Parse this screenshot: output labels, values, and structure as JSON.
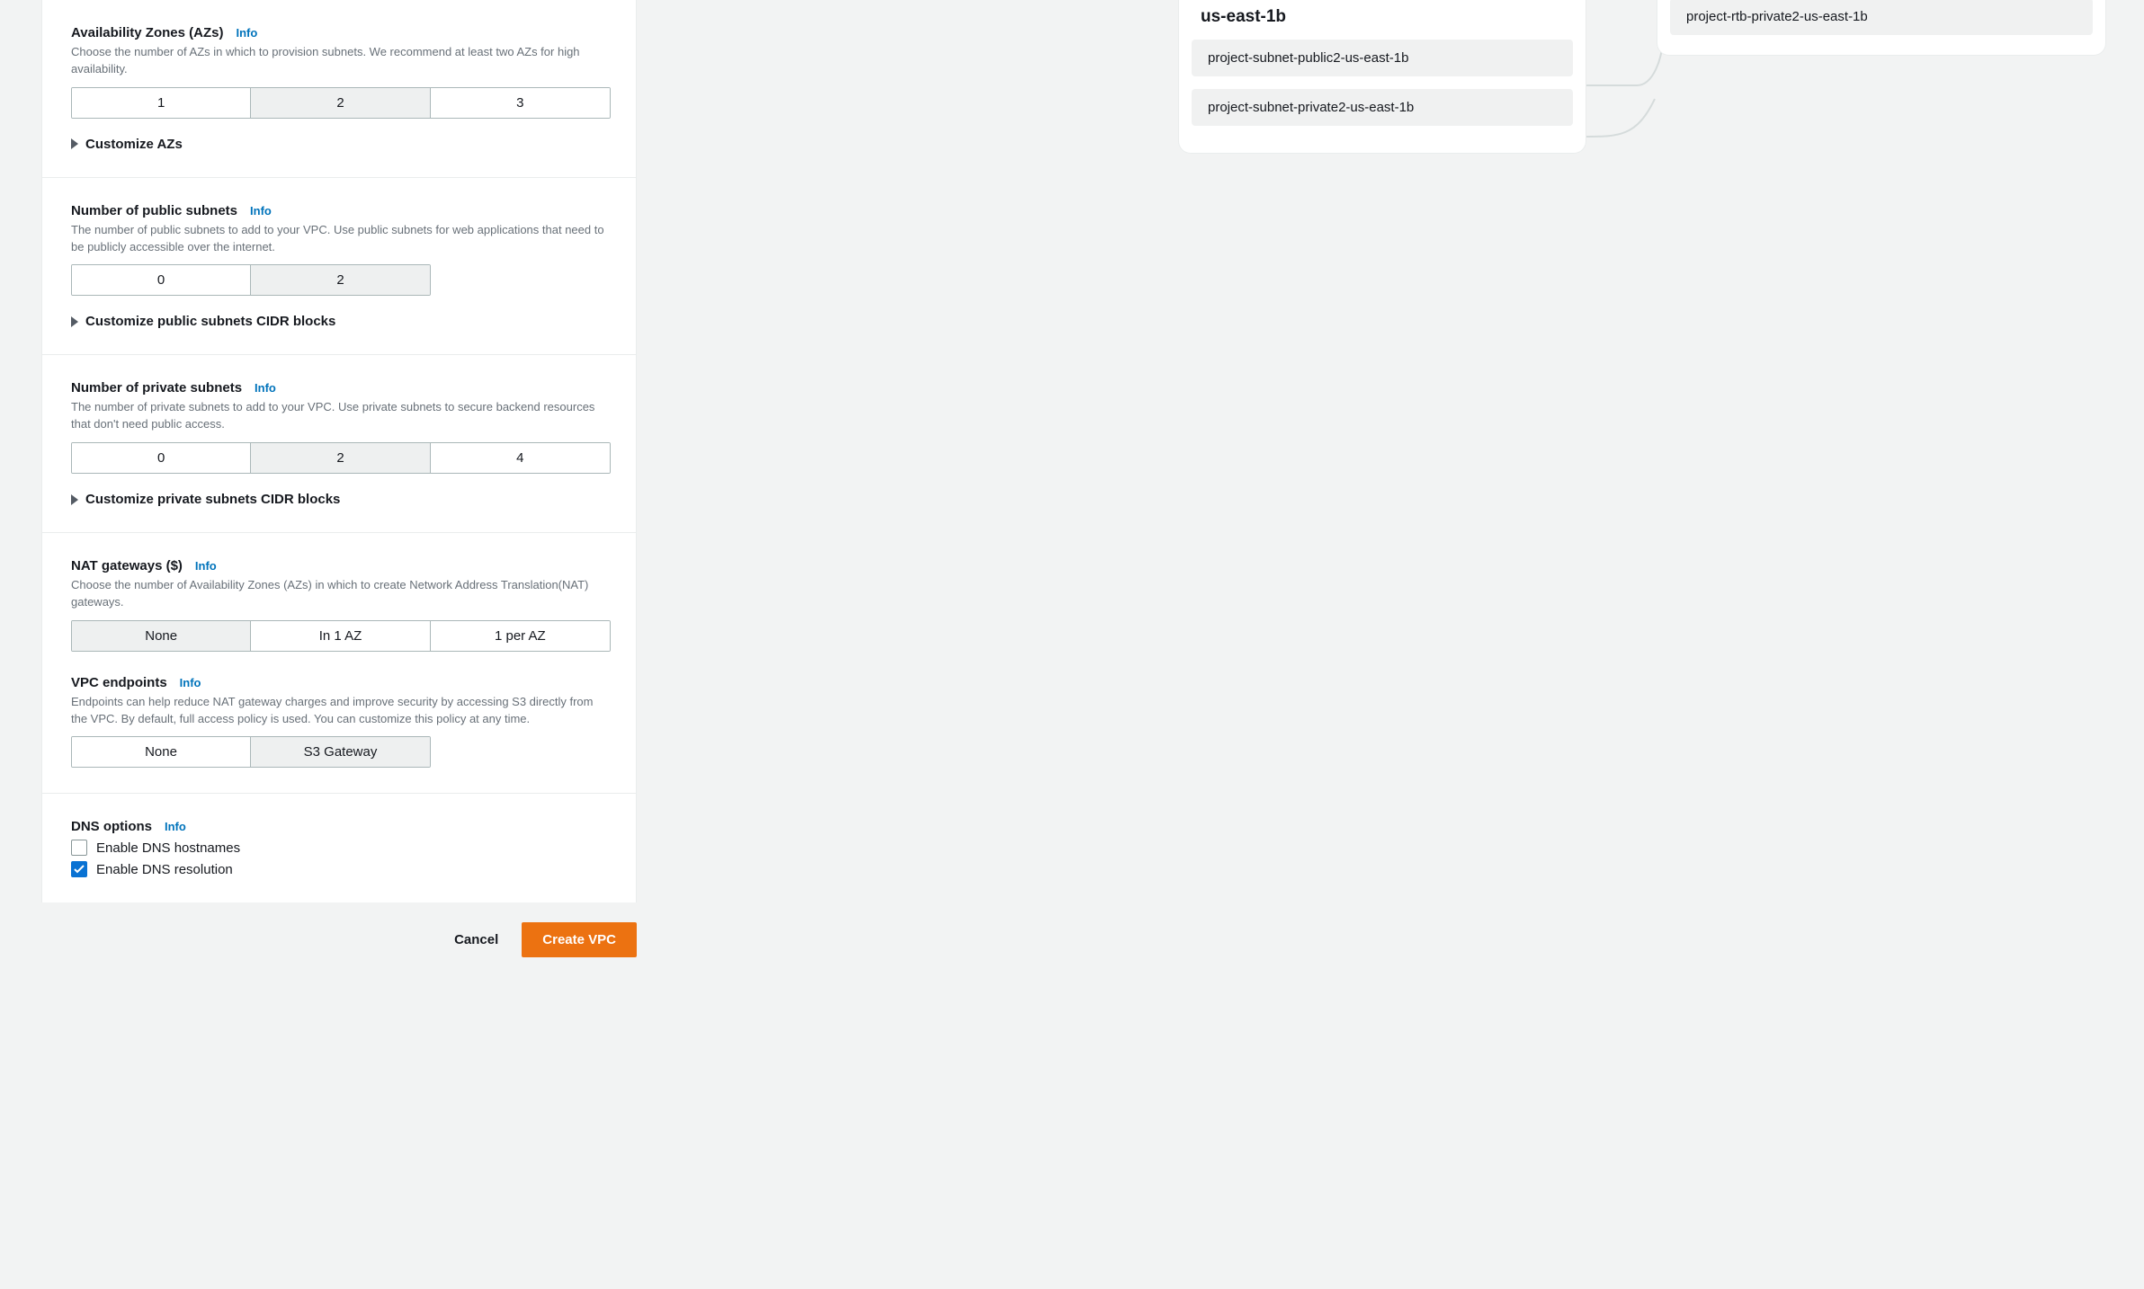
{
  "info_label": "Info",
  "sections": {
    "az": {
      "label": "Availability Zones (AZs)",
      "desc": "Choose the number of AZs in which to provision subnets. We recommend at least two AZs for high availability.",
      "options": [
        "1",
        "2",
        "3"
      ],
      "selected": "2",
      "expand": "Customize AZs"
    },
    "pub": {
      "label": "Number of public subnets",
      "desc": "The number of public subnets to add to your VPC. Use public subnets for web applications that need to be publicly accessible over the internet.",
      "options": [
        "0",
        "2"
      ],
      "selected": "2",
      "expand": "Customize public subnets CIDR blocks"
    },
    "priv": {
      "label": "Number of private subnets",
      "desc": "The number of private subnets to add to your VPC. Use private subnets to secure backend resources that don't need public access.",
      "options": [
        "0",
        "2",
        "4"
      ],
      "selected": "2",
      "expand": "Customize private subnets CIDR blocks"
    },
    "nat": {
      "label": "NAT gateways ($)",
      "desc": "Choose the number of Availability Zones (AZs) in which to create Network Address Translation(NAT) gateways.",
      "options": [
        "None",
        "In 1 AZ",
        "1 per AZ"
      ],
      "selected": "None"
    },
    "vpce": {
      "label": "VPC endpoints",
      "desc": "Endpoints can help reduce NAT gateway charges and improve security by accessing S3 directly from the VPC. By default, full access policy is used. You can customize this policy at any time.",
      "options": [
        "None",
        "S3 Gateway"
      ],
      "selected": "S3 Gateway"
    },
    "dns": {
      "label": "DNS options",
      "hostnames_label": "Enable DNS hostnames",
      "hostnames_checked": false,
      "resolution_label": "Enable DNS resolution",
      "resolution_checked": true
    }
  },
  "actions": {
    "cancel": "Cancel",
    "create": "Create VPC"
  },
  "diagram": {
    "az_name": "us-east-1b",
    "subnets": [
      "project-subnet-public2-us-east-1b",
      "project-subnet-private2-us-east-1b"
    ],
    "route_table": "project-rtb-private2-us-east-1b"
  }
}
